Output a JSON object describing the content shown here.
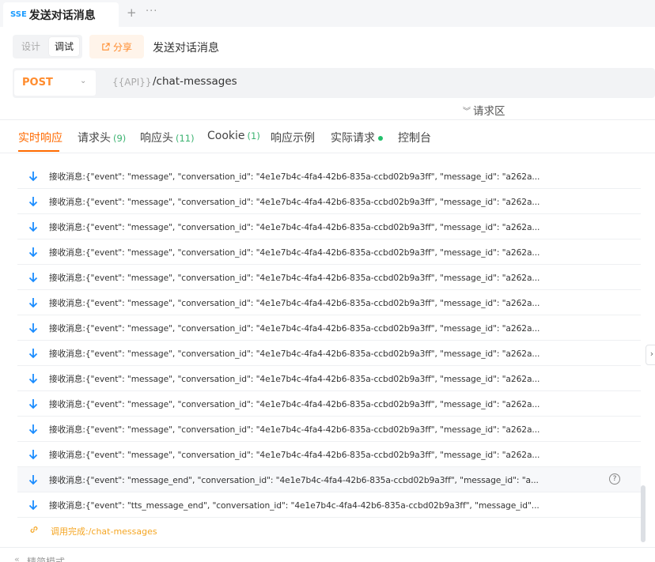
{
  "top": {
    "sse_badge": "SSE",
    "tab_title": "发送对话消息",
    "plus": "+",
    "more": "···"
  },
  "mode": {
    "design": "设计",
    "debug": "调试",
    "share": "分享",
    "api_name": "发送对话消息"
  },
  "url": {
    "method": "POST",
    "api_var": "{{API}}",
    "path": "/chat-messages"
  },
  "request_area": {
    "label": "请求区"
  },
  "tabs": [
    {
      "label": "实时响应",
      "count": ""
    },
    {
      "label": "请求头",
      "count": "(9)"
    },
    {
      "label": "响应头",
      "count": "(11)"
    },
    {
      "label": "Cookie",
      "count": "(1)"
    },
    {
      "label": "响应示例",
      "count": ""
    },
    {
      "label": "实际请求",
      "count": ""
    },
    {
      "label": "控制台",
      "count": ""
    }
  ],
  "messages": [
    "接收消息:{\"event\": \"message\", \"conversation_id\": \"4e1e7b4c-4fa4-42b6-835a-ccbd02b9a3ff\", \"message_id\": \"a262a...",
    "接收消息:{\"event\": \"message\", \"conversation_id\": \"4e1e7b4c-4fa4-42b6-835a-ccbd02b9a3ff\", \"message_id\": \"a262a...",
    "接收消息:{\"event\": \"message\", \"conversation_id\": \"4e1e7b4c-4fa4-42b6-835a-ccbd02b9a3ff\", \"message_id\": \"a262a...",
    "接收消息:{\"event\": \"message\", \"conversation_id\": \"4e1e7b4c-4fa4-42b6-835a-ccbd02b9a3ff\", \"message_id\": \"a262a...",
    "接收消息:{\"event\": \"message\", \"conversation_id\": \"4e1e7b4c-4fa4-42b6-835a-ccbd02b9a3ff\", \"message_id\": \"a262a...",
    "接收消息:{\"event\": \"message\", \"conversation_id\": \"4e1e7b4c-4fa4-42b6-835a-ccbd02b9a3ff\", \"message_id\": \"a262a...",
    "接收消息:{\"event\": \"message\", \"conversation_id\": \"4e1e7b4c-4fa4-42b6-835a-ccbd02b9a3ff\", \"message_id\": \"a262a...",
    "接收消息:{\"event\": \"message\", \"conversation_id\": \"4e1e7b4c-4fa4-42b6-835a-ccbd02b9a3ff\", \"message_id\": \"a262a...",
    "接收消息:{\"event\": \"message\", \"conversation_id\": \"4e1e7b4c-4fa4-42b6-835a-ccbd02b9a3ff\", \"message_id\": \"a262a...",
    "接收消息:{\"event\": \"message\", \"conversation_id\": \"4e1e7b4c-4fa4-42b6-835a-ccbd02b9a3ff\", \"message_id\": \"a262a...",
    "接收消息:{\"event\": \"message\", \"conversation_id\": \"4e1e7b4c-4fa4-42b6-835a-ccbd02b9a3ff\", \"message_id\": \"a262a...",
    "接收消息:{\"event\": \"message\", \"conversation_id\": \"4e1e7b4c-4fa4-42b6-835a-ccbd02b9a3ff\", \"message_id\": \"a262a...",
    "接收消息:{\"event\": \"message_end\", \"conversation_id\": \"4e1e7b4c-4fa4-42b6-835a-ccbd02b9a3ff\", \"message_id\": \"a...",
    "接收消息:{\"event\": \"tts_message_end\", \"conversation_id\": \"4e1e7b4c-4fa4-42b6-835a-ccbd02b9a3ff\", \"message_id\"..."
  ],
  "done": {
    "text": "调用完成:/chat-messages"
  },
  "bottom": {
    "label": "精简模式"
  },
  "colors": {
    "accent": "#ff6a00",
    "method": "#ff8c2e",
    "count": "#3cb371",
    "arrow": "#1a8cff"
  },
  "icons": {
    "receive": "arrow-down-icon",
    "help": "help-circle-icon",
    "done": "link-icon"
  }
}
